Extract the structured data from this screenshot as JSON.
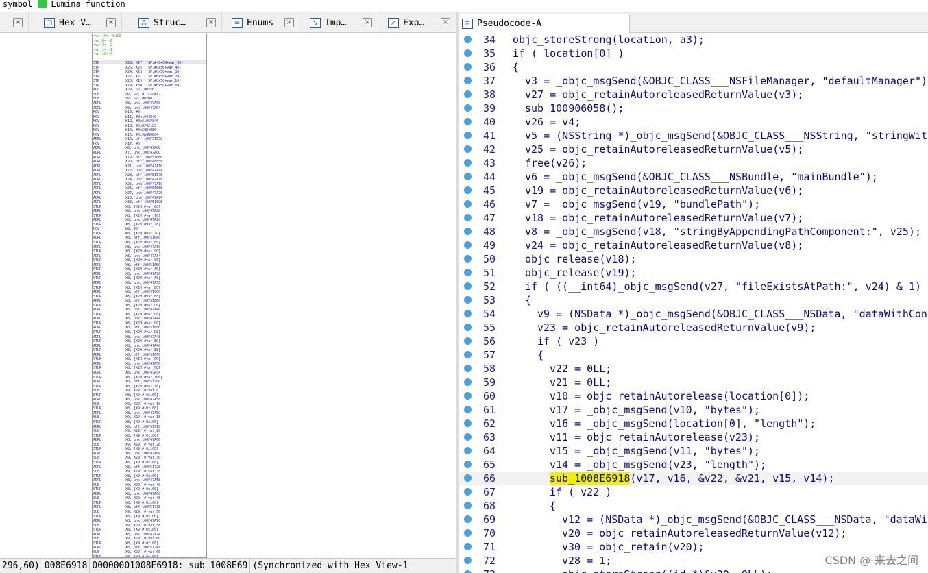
{
  "legend": {
    "items": [
      {
        "label": "symbol",
        "color": ""
      },
      {
        "label": "Lumina function",
        "color": "#2ecc40"
      }
    ]
  },
  "left_tabs": [
    {
      "label": "",
      "icon": "view-icon"
    },
    {
      "label": "Hex V…",
      "icon": "hex-view-icon"
    },
    {
      "label": "Struc…",
      "icon": "structures-icon"
    },
    {
      "label": "Enums",
      "icon": "enums-icon"
    },
    {
      "label": "Imp…",
      "icon": "imports-icon"
    },
    {
      "label": "Exp…",
      "icon": "exports-icon"
    }
  ],
  "close_glyph": "×",
  "ida_node": {
    "header_lines": [
      "var_10= -0x10",
      "var_8= -8",
      "var_2= -2",
      "var_1= -1",
      "var_s0= 0"
    ],
    "rows": [
      [
        "STP",
        "X28, X27, [SP,#-0x60+var_50]!"
      ],
      [
        "STP",
        "X26, X25, [SP,#0x50+var_40]"
      ],
      [
        "STP",
        "X24, X23, [SP,#0x50+var_30]"
      ],
      [
        "STP",
        "X22, X21, [SP,#0x50+var_20]"
      ],
      [
        "STP",
        "X20, X19, [SP,#0x50+var_10]"
      ],
      [
        "STP",
        "X29, X30, [SP,#0x50+var_s0]"
      ],
      [
        "ADD",
        "X29, SP, #0x50"
      ],
      [
        "SUB",
        "SP, SP, #1,LSL#12"
      ],
      [
        "SUB",
        "SP, SP, #0xD0"
      ],
      [
        "ADRL",
        "X8, unk_100F47A00"
      ],
      [
        "ADRL",
        "X9, unk_100F47A04"
      ],
      [
        "MOV",
        "W10, #0"
      ],
      [
        "MOV",
        "W11, #0x1C94E4C"
      ],
      [
        "MOV",
        "W12, #0x6195F840"
      ],
      [
        "MOV",
        "W13, #0x0F42185"
      ],
      [
        "MOV",
        "W14, #0x58B40E6"
      ],
      [
        "MOV",
        "W15, #0x9A0B0B04"
      ],
      [
        "ADRL",
        "X16, off_100F51658"
      ],
      [
        "MOV",
        "X17, #0"
      ],
      [
        "ADRL",
        "X6, unk_100F47A08"
      ],
      [
        "ADRL",
        "X7, unk_100F47A0C"
      ],
      [
        "ADRL",
        "X19, off_100F51660"
      ],
      [
        "ADRL",
        "X20, off_100F48858"
      ],
      [
        "ADRL",
        "X21, unk_100F47A10"
      ],
      [
        "ADRL",
        "X22, unk_100F47A14"
      ],
      [
        "ADRL",
        "X23, off_100F51678"
      ],
      [
        "ADRL",
        "X24, unk_100F47A18"
      ],
      [
        "ADRL",
        "X25, unk_100F47A1C"
      ],
      [
        "ADRL",
        "X26, off_100F51688"
      ],
      [
        "ADRL",
        "X27, unk_100F47A20"
      ],
      [
        "ADRL",
        "X28, unk_100F47A24"
      ],
      [
        "ADRL",
        "X30, off_100F51698"
      ],
      [
        "STUR",
        "X8, [X29,#var_68]"
      ],
      [
        "ADRL",
        "X8, unk_100F47A28"
      ],
      [
        "STUR",
        "X8, [X29,#var_70]"
      ],
      [
        "ADRL",
        "X8, unk_100F47A2C"
      ],
      [
        "STUR",
        "X8, [X29,#var_78]"
      ],
      [
        "MOV",
        "W8, #0"
      ],
      [
        "STUR",
        "W8, [X29,#var_7C]"
      ],
      [
        "ADRL",
        "X8, off_100F516A0"
      ],
      [
        "STUR",
        "X8, [X29,#var_88]"
      ],
      [
        "ADRL",
        "X8, unk_100F47A30"
      ],
      [
        "STUR",
        "X8, [X29,#var_90]"
      ],
      [
        "ADRL",
        "X8, unk_100F47A34"
      ],
      [
        "STUR",
        "X8, [X29,#var_98]"
      ],
      [
        "ADRL",
        "X8, off_100F516B0"
      ],
      [
        "STUR",
        "X8, [X29,#var_A0]"
      ],
      [
        "ADRL",
        "X8, unk_100F47A38"
      ],
      [
        "STUR",
        "X8, [X29,#var_A8]"
      ],
      [
        "ADRL",
        "X8, unk_100F47A3C"
      ],
      [
        "STUR",
        "X8, [X29,#var_B0]"
      ],
      [
        "ADRL",
        "X8, off_100F516C0"
      ],
      [
        "STUR",
        "X8, [X29,#var_B8]"
      ],
      [
        "ADRL",
        "X8, off_100F516D0"
      ],
      [
        "STUR",
        "X8, [X29,#var_C0]"
      ],
      [
        "ADRL",
        "X8, unk_100F47A40"
      ],
      [
        "STUR",
        "X8, [X29,#var_C8]"
      ],
      [
        "ADRL",
        "X8, unk_100F47A44"
      ],
      [
        "STUR",
        "X8, [X29,#var_D0]"
      ],
      [
        "ADRL",
        "X8, off_100F516E0"
      ],
      [
        "STUR",
        "X8, [X29,#var_D8]"
      ],
      [
        "ADRL",
        "X8, unk_100F47A48"
      ],
      [
        "STUR",
        "X8, [X29,#var_E0]"
      ],
      [
        "ADRL",
        "X8, unk_100F47A4C"
      ],
      [
        "STUR",
        "X8, [X29,#var_E8]"
      ],
      [
        "ADRL",
        "X8, off_100F516F0"
      ],
      [
        "STUR",
        "X8, [X29,#var_F0]"
      ],
      [
        "ADRL",
        "X8, unk_100F47A50"
      ],
      [
        "STUR",
        "X8, [X29,#var_F8]"
      ],
      [
        "ADRL",
        "X8, unk_100F47A54"
      ],
      [
        "STUR",
        "X8, [X29,#var_100]"
      ],
      [
        "ADRL",
        "X8, off_100F51700"
      ],
      [
        "STUR",
        "X8, [X29,#var_18]"
      ],
      [
        "SUB",
        "X9, X29, #-var_8"
      ],
      [
        "STUR",
        "X8, [X9,#-0x100]"
      ],
      [
        "ADRL",
        "X8, unk_100F47A58"
      ],
      [
        "SUB",
        "X9, X29, #-var_10"
      ],
      [
        "STUR",
        "X8, [X9,#-0x100]"
      ],
      [
        "ADRL",
        "X8, unk_100F47A5C"
      ],
      [
        "SUB",
        "X9, X29, #-var_18"
      ],
      [
        "STUR",
        "X8, [X9,#-0x100]"
      ],
      [
        "ADRL",
        "X8, off_100F51718"
      ],
      [
        "SUB",
        "X9, X29, #-var_20"
      ],
      [
        "STUR",
        "X8, [X9,#-0x100]"
      ],
      [
        "ADRL",
        "X8, unk_100F47A60"
      ],
      [
        "SUB",
        "X9, X29, #-var_28"
      ],
      [
        "STUR",
        "X8, [X9,#-0x100]"
      ],
      [
        "ADRL",
        "X8, unk_100F47A64"
      ],
      [
        "SUB",
        "X9, X29, #-var_30"
      ],
      [
        "STUR",
        "X8, [X9,#-0x100]"
      ],
      [
        "ADRL",
        "X8, off_100F51728"
      ],
      [
        "SUB",
        "X9, X29, #-var_38"
      ],
      [
        "STUR",
        "X8, [X9,#-0x100]"
      ],
      [
        "ADRL",
        "X8, unk_100F47A68"
      ],
      [
        "SUB",
        "X9, X29, #-var_40"
      ],
      [
        "STUR",
        "X8, [X9,#-0x100]"
      ],
      [
        "ADRL",
        "X8, unk_100F47A6C"
      ],
      [
        "SUB",
        "X9, X29, #-var_48"
      ],
      [
        "STUR",
        "X8, [X9,#-0x100]"
      ],
      [
        "ADRL",
        "X8, off_100F51738"
      ],
      [
        "SUB",
        "X9, X29, #-var_50"
      ],
      [
        "STUR",
        "X8, [X9,#-0x100]"
      ],
      [
        "ADRL",
        "X8, unk_100F47A70"
      ],
      [
        "SUB",
        "X9, X29, #-var_58"
      ],
      [
        "STUR",
        "X8, [X9,#-0x100]"
      ],
      [
        "ADRL",
        "X8, unk_100F47A74"
      ],
      [
        "SUB",
        "X9, X29, #-var_60"
      ],
      [
        "STUR",
        "X8, [X9,#-0x100]"
      ],
      [
        "ADRL",
        "X8, off_100F51748"
      ],
      [
        "SUB",
        "X9, X29, #-var_68"
      ],
      [
        "STUR",
        "X8, [X9,#-0x100]"
      ]
    ]
  },
  "status_bar": {
    "cells": [
      "296,60)",
      "008E6918",
      "00000001008E6918: sub_1008E69",
      "(Synchronized with Hex View-1"
    ]
  },
  "pseudocode": {
    "tab_label": "Pseudocode-A",
    "highlight_symbol": "sub_1008E6918",
    "lines": [
      {
        "n": "34",
        "indent": 0,
        "text": "objc_storeStrong(location, a3);"
      },
      {
        "n": "35",
        "indent": 0,
        "text": "if ( location[0] )"
      },
      {
        "n": "36",
        "indent": 0,
        "text": "{"
      },
      {
        "n": "37",
        "indent": 1,
        "text": "v3 = _objc_msgSend(&OBJC_CLASS___NSFileManager, \"defaultManager\");"
      },
      {
        "n": "38",
        "indent": 1,
        "text": "v27 = objc_retainAutoreleasedReturnValue(v3);"
      },
      {
        "n": "39",
        "indent": 1,
        "text": "sub_100906058();"
      },
      {
        "n": "40",
        "indent": 1,
        "text": "v26 = v4;"
      },
      {
        "n": "41",
        "indent": 1,
        "text": "v5 = (NSString *)_objc_msgSend(&OBJC_CLASS___NSString, \"stringWith"
      },
      {
        "n": "42",
        "indent": 1,
        "text": "v25 = objc_retainAutoreleasedReturnValue(v5);"
      },
      {
        "n": "43",
        "indent": 1,
        "text": "free(v26);"
      },
      {
        "n": "44",
        "indent": 1,
        "text": "v6 = _objc_msgSend(&OBJC_CLASS___NSBundle, \"mainBundle\");"
      },
      {
        "n": "45",
        "indent": 1,
        "text": "v19 = objc_retainAutoreleasedReturnValue(v6);"
      },
      {
        "n": "46",
        "indent": 1,
        "text": "v7 = _objc_msgSend(v19, \"bundlePath\");"
      },
      {
        "n": "47",
        "indent": 1,
        "text": "v18 = objc_retainAutoreleasedReturnValue(v7);"
      },
      {
        "n": "48",
        "indent": 1,
        "text": "v8 = _objc_msgSend(v18, \"stringByAppendingPathComponent:\", v25);"
      },
      {
        "n": "49",
        "indent": 1,
        "text": "v24 = objc_retainAutoreleasedReturnValue(v8);"
      },
      {
        "n": "50",
        "indent": 1,
        "text": "objc_release(v18);"
      },
      {
        "n": "51",
        "indent": 1,
        "text": "objc_release(v19);"
      },
      {
        "n": "52",
        "indent": 1,
        "text": "if ( ((__int64)_objc_msgSend(v27, \"fileExistsAtPath:\", v24) & 1)"
      },
      {
        "n": "53",
        "indent": 1,
        "text": "{"
      },
      {
        "n": "54",
        "indent": 2,
        "text": "v9 = (NSData *)_objc_msgSend(&OBJC_CLASS___NSData, \"dataWithCont"
      },
      {
        "n": "55",
        "indent": 2,
        "text": "v23 = objc_retainAutoreleasedReturnValue(v9);"
      },
      {
        "n": "56",
        "indent": 2,
        "text": "if ( v23 )"
      },
      {
        "n": "57",
        "indent": 2,
        "text": "{"
      },
      {
        "n": "58",
        "indent": 3,
        "text": "v22 = 0LL;"
      },
      {
        "n": "59",
        "indent": 3,
        "text": "v21 = 0LL;"
      },
      {
        "n": "60",
        "indent": 3,
        "text": "v10 = objc_retainAutorelease(location[0]);"
      },
      {
        "n": "61",
        "indent": 3,
        "text": "v17 = _objc_msgSend(v10, \"bytes\");"
      },
      {
        "n": "62",
        "indent": 3,
        "text": "v16 = _objc_msgSend(location[0], \"length\");"
      },
      {
        "n": "63",
        "indent": 3,
        "text": "v11 = objc_retainAutorelease(v23);"
      },
      {
        "n": "64",
        "indent": 3,
        "text": "v15 = _objc_msgSend(v11, \"bytes\");"
      },
      {
        "n": "65",
        "indent": 3,
        "text": "v14 = _objc_msgSend(v23, \"length\");"
      },
      {
        "n": "66",
        "indent": 3,
        "text": "sub_1008E6918(v17, v16, &v22, &v21, v15, v14);",
        "hl": true
      },
      {
        "n": "67",
        "indent": 3,
        "text": "if ( v22 )"
      },
      {
        "n": "68",
        "indent": 3,
        "text": "{"
      },
      {
        "n": "69",
        "indent": 4,
        "text": "v12 = (NSData *)_objc_msgSend(&OBJC_CLASS___NSData, \"dataWit"
      },
      {
        "n": "70",
        "indent": 4,
        "text": "v20 = objc_retainAutoreleasedReturnValue(v12);"
      },
      {
        "n": "71",
        "indent": 4,
        "text": "v30 = objc_retain(v20);"
      },
      {
        "n": "72",
        "indent": 4,
        "text": "v28 = 1;"
      },
      {
        "n": "73",
        "indent": 4,
        "text": "objc_storeStrong((id *)&v20, 0LL);"
      }
    ]
  },
  "watermark": "CSDN @-来去之间"
}
